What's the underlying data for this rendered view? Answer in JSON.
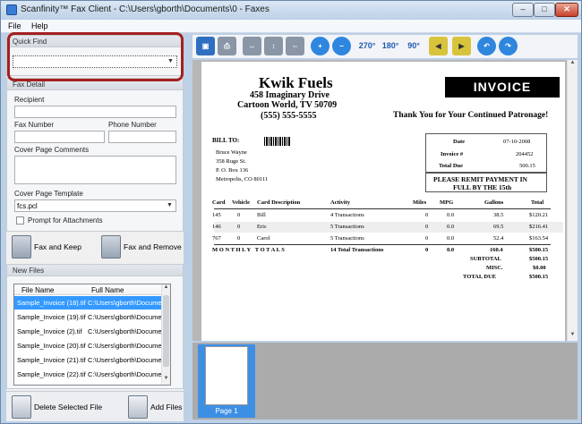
{
  "window": {
    "title": "Scanfinity™ Fax Client - C:\\Users\\gborth\\Documents\\0 - Faxes",
    "min": "–",
    "max": "□",
    "close": "✕"
  },
  "menu": {
    "file": "File",
    "help": "Help"
  },
  "quick_find": {
    "title": "Quick Find",
    "value": ""
  },
  "fax_detail": {
    "title": "Fax Detail",
    "recipient_label": "Recipient",
    "fax_number_label": "Fax Number",
    "phone_number_label": "Phone Number",
    "cover_comments_label": "Cover Page Comments",
    "cover_template_label": "Cover Page Template",
    "cover_template_value": "fcs.pcl",
    "prompt_attachments_label": "Prompt for Attachments"
  },
  "actions": {
    "fax_keep": "Fax and Keep",
    "fax_remove": "Fax and Remove",
    "delete_file": "Delete Selected File",
    "add_files": "Add Files"
  },
  "new_files": {
    "title": "New Files",
    "columns": [
      "File Name",
      "Full Name"
    ],
    "rows": [
      {
        "file": "Sample_Invoice (18).tif",
        "full": "C:\\Users\\gborth\\Documen"
      },
      {
        "file": "Sample_Invoice (19).tif",
        "full": "C:\\Users\\gborth\\Documen"
      },
      {
        "file": "Sample_Invoice (2).tif",
        "full": "C:\\Users\\gborth\\Documen"
      },
      {
        "file": "Sample_Invoice (20).tif",
        "full": "C:\\Users\\gborth\\Documen"
      },
      {
        "file": "Sample_Invoice (21).tif",
        "full": "C:\\Users\\gborth\\Documen"
      },
      {
        "file": "Sample_Invoice (22).tif",
        "full": "C:\\Users\\gborth\\Documen"
      }
    ]
  },
  "toolbar": {
    "rot270": "270°",
    "rot180": "180°",
    "rot90": "90°"
  },
  "invoice": {
    "company": "Kwik Fuels",
    "addr1": "458 Imaginary Drive",
    "addr2": "Cartoon World, TV 50709",
    "phone": "(555) 555-5555",
    "logo": "INVOICE",
    "thanks": "Thank You for Your Continued Patronage!",
    "bill_to": "BILL TO:",
    "bill_lines": [
      "Bruce Wayne",
      "358 Ruge St.",
      "P. O. Box 136",
      "Metropolis, CO 80111"
    ],
    "date_label": "Date",
    "date_value": "07-10-2008",
    "invoice_label": "Invoice #",
    "invoice_value": "204452",
    "total_due_label": "Total Due",
    "total_due_value": "500.15",
    "remit1": "PLEASE REMIT PAYMENT IN",
    "remit2": "FULL BY THE 15th",
    "headers": [
      "Card",
      "Vehicle",
      "Card Description",
      "Activity",
      "Miles",
      "MPG",
      "Gallons",
      "Total"
    ],
    "rows": [
      [
        "145",
        "0",
        "Bill",
        "4 Transactions",
        "0",
        "0.0",
        "38.5",
        "$120.21"
      ],
      [
        "146",
        "0",
        "Eric",
        "5 Transactions",
        "0",
        "0.0",
        "69.5",
        "$216.41"
      ],
      [
        "767",
        "0",
        "Carol",
        "5 Transactions",
        "0",
        "0.0",
        "52.4",
        "$163.54"
      ]
    ],
    "monthly": [
      "M O N T H L Y   T O T A L S",
      "14 Total Transactions",
      "0",
      "0.0",
      "160.4",
      "$500.15"
    ],
    "subtotal_label": "SUBTOTAL",
    "subtotal_value": "$500.15",
    "misc_label": "MISC.",
    "misc_value": "$0.00",
    "totaldue_label": "TOTAL DUE",
    "totaldue_value": "$500.15"
  },
  "thumbnails": [
    {
      "label": "Page 1"
    }
  ]
}
